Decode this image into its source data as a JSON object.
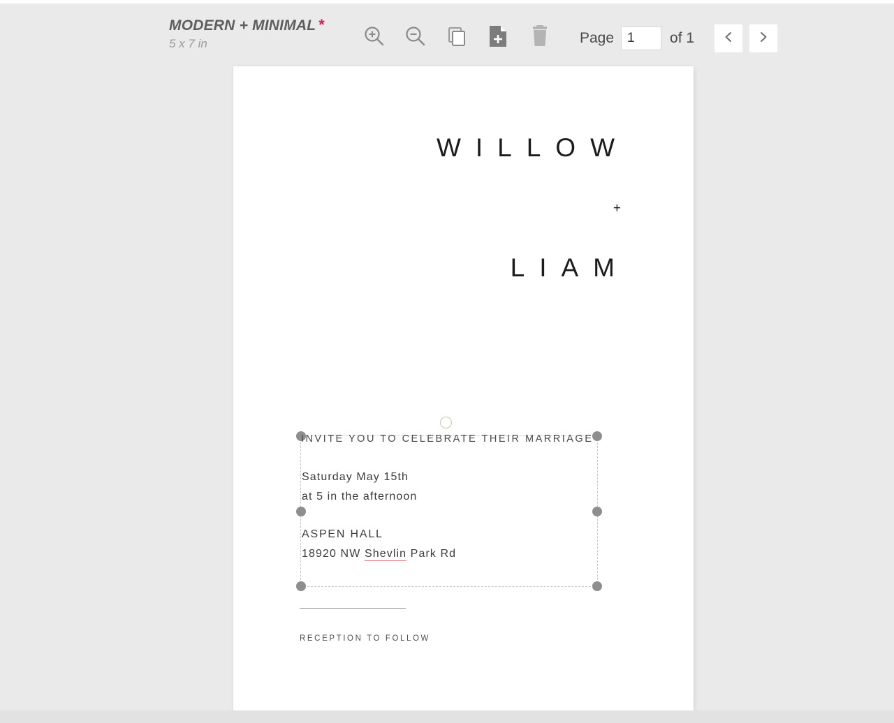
{
  "toolbar": {
    "document_title": "MODERN + MINIMAL",
    "unsaved_marker": "*",
    "document_size": "5 x 7 in",
    "buttons": [
      {
        "name": "zoom-in",
        "label": "Zoom In"
      },
      {
        "name": "zoom-out",
        "label": "Zoom Out"
      },
      {
        "name": "duplicate-page",
        "label": "Duplicate Page"
      },
      {
        "name": "add-page",
        "label": "Add Page"
      },
      {
        "name": "delete-page",
        "label": "Delete Page"
      }
    ]
  },
  "page_nav": {
    "page_label": "Page",
    "current_page": "1",
    "page_placeholder": "1",
    "total_label": "of 1",
    "prev_icon": "chevron-left-icon",
    "next_icon": "chevron-right-icon"
  },
  "canvas": {
    "names": {
      "first": "WILLOW",
      "joiner": "+",
      "second": "LIAM"
    },
    "invite": {
      "headline": "INVITE YOU TO CELEBRATE THEIR MARRIAGE",
      "date": "Saturday May 15th",
      "time": "at 5 in the afternoon",
      "venue": "ASPEN HALL",
      "address_prefix": "18920 NW ",
      "address_misspelled": "Shevlin",
      "address_suffix": " Park Rd",
      "footer": "RECEPTION TO FOLLOW"
    }
  },
  "colors": {
    "accent": "#e0115f",
    "app_background": "#eaeaea",
    "handle": "#8e8e8e",
    "spellcheck_underline": "#e7737f",
    "text_dark": "#1c1c1c"
  }
}
